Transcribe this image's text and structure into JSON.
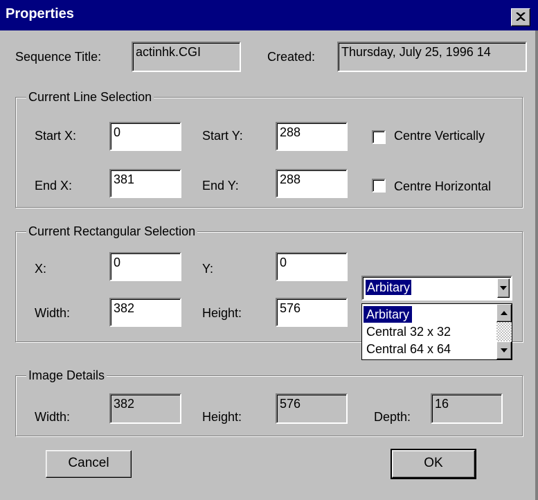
{
  "window": {
    "title": "Properties"
  },
  "header": {
    "sequence_title_label": "Sequence Title:",
    "sequence_title_value": "actinhk.CGI",
    "created_label": "Created:",
    "created_value": "Thursday, July 25, 1996 14"
  },
  "line_selection": {
    "legend": "Current Line Selection",
    "start_x_label": "Start X:",
    "start_x_value": "0",
    "start_y_label": "Start Y:",
    "start_y_value": "288",
    "end_x_label": "End X:",
    "end_x_value": "381",
    "end_y_label": "End Y:",
    "end_y_value": "288",
    "centre_vertically_label": "Centre Vertically",
    "centre_horizontal_label": "Centre Horizontal"
  },
  "rect_selection": {
    "legend": "Current Rectangular Selection",
    "x_label": "X:",
    "x_value": "0",
    "y_label": "Y:",
    "y_value": "0",
    "width_label": "Width:",
    "width_value": "382",
    "height_label": "Height:",
    "height_value": "576",
    "preset_selected": "Arbitary",
    "preset_options": [
      "Arbitary",
      "Central 32 x 32",
      "Central 64 x 64"
    ]
  },
  "image_details": {
    "legend": "Image Details",
    "width_label": "Width:",
    "width_value": "382",
    "height_label": "Height:",
    "height_value": "576",
    "depth_label": "Depth:",
    "depth_value": "16"
  },
  "buttons": {
    "cancel": "Cancel",
    "ok": "OK"
  },
  "colors": {
    "titlebar": "#000080",
    "face": "#c0c0c0",
    "highlight": "#000080"
  },
  "icons": {
    "close": "close-icon",
    "dropdown": "chevron-down-icon",
    "scroll_up": "arrow-up-icon",
    "scroll_down": "arrow-down-icon"
  }
}
